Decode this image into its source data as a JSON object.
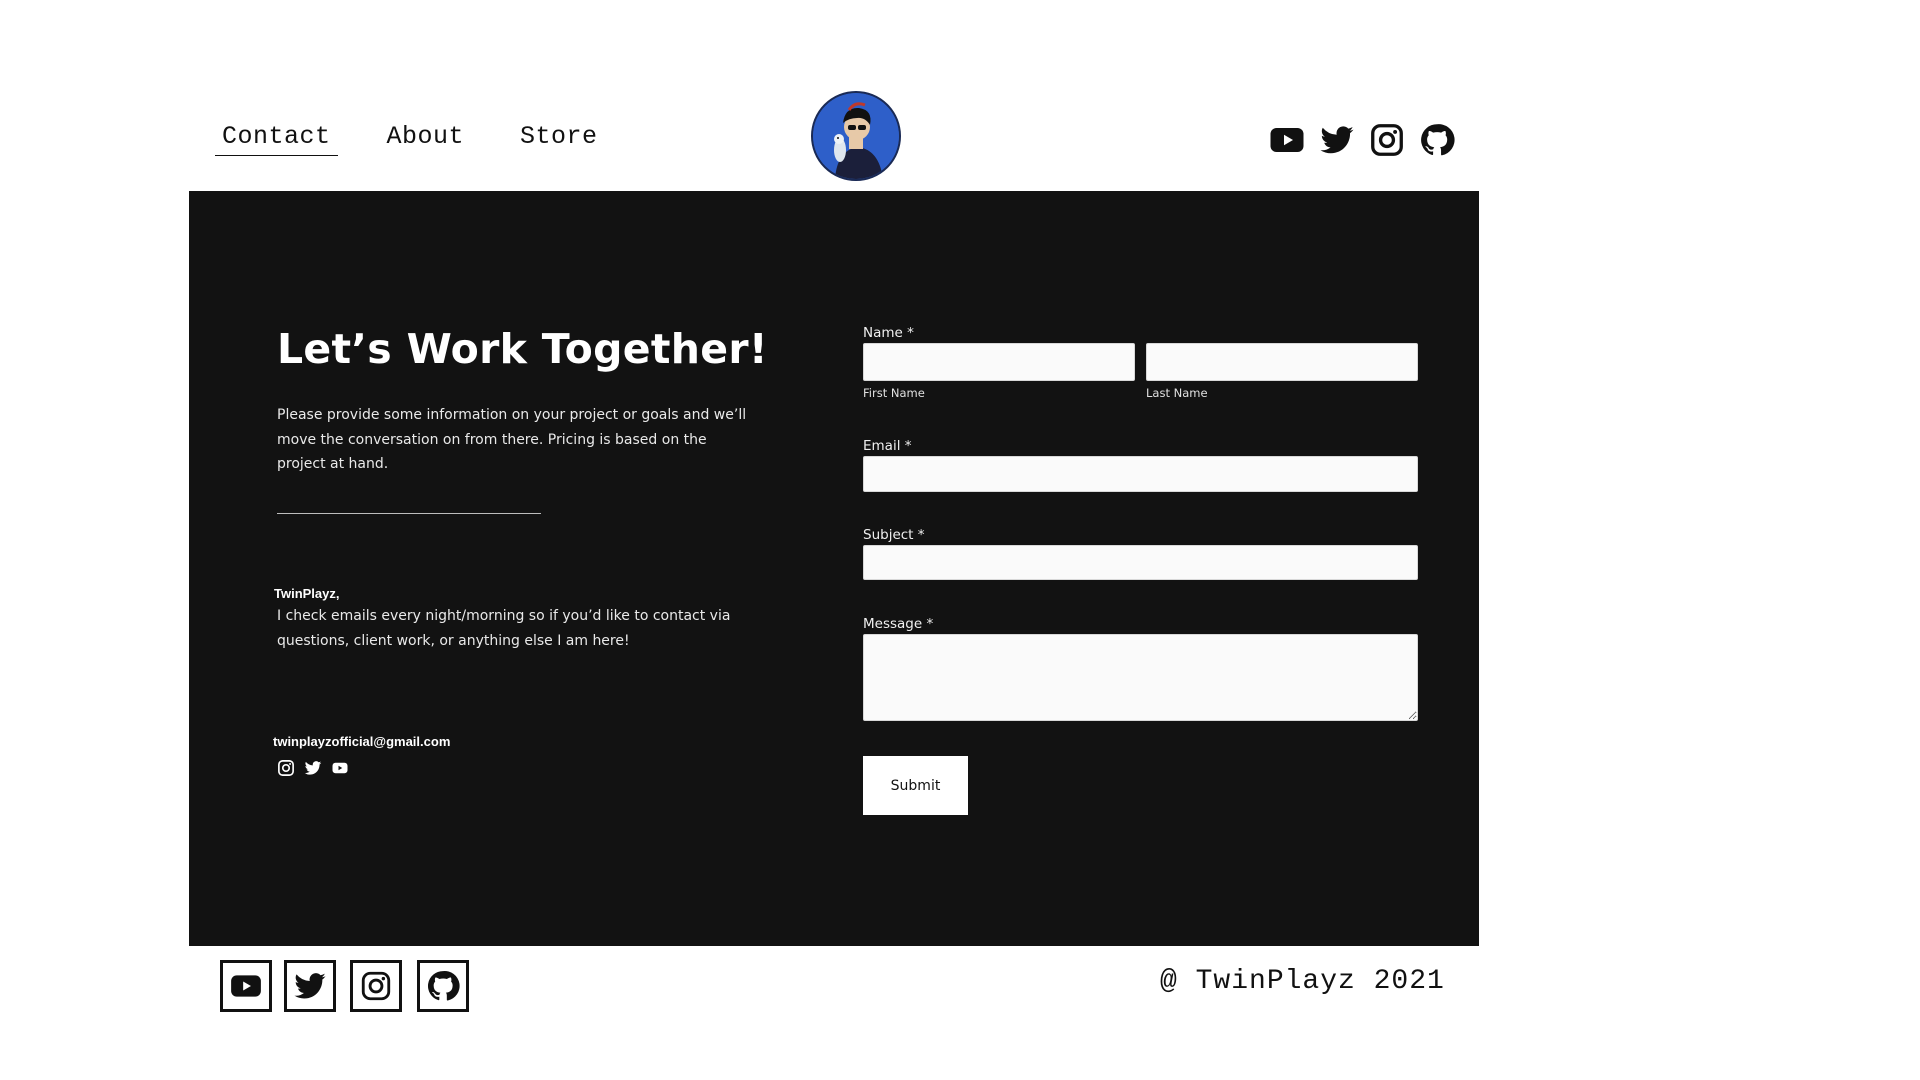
{
  "nav": {
    "items": [
      {
        "label": "Contact",
        "active": true
      },
      {
        "label": "About",
        "active": false
      },
      {
        "label": "Store",
        "active": false
      }
    ]
  },
  "header": {
    "logo_icon": "avatar-person-with-dog",
    "social_icons": [
      "youtube-icon",
      "twitter-icon",
      "instagram-icon",
      "github-icon"
    ]
  },
  "contact": {
    "title": "Let’s Work Together!",
    "intro": "Please provide some information on your project or goals and we’ll move the conversation on from there. Pricing is based on the project at hand.",
    "signature": "TwinPlayz,",
    "note": "I check emails every night/morning so if you’d like to contact via questions, client work, or anything else I am here!",
    "email": "twinplayzofficial@gmail.com",
    "social_icons": [
      "instagram-icon",
      "twitter-icon",
      "youtube-icon"
    ]
  },
  "form": {
    "name_label": "Name *",
    "first_name_label": "First Name",
    "last_name_label": "Last Name",
    "first_name_value": "",
    "last_name_value": "",
    "email_label": "Email *",
    "email_value": "",
    "subject_label": "Subject *",
    "subject_value": "",
    "message_label": "Message *",
    "message_value": "",
    "submit_label": "Submit"
  },
  "footer": {
    "social_icons": [
      "youtube-icon",
      "twitter-icon",
      "instagram-icon",
      "github-icon"
    ],
    "copyright": "@ TwinPlayz 2021"
  },
  "colors": {
    "panel_bg": "#121212",
    "page_bg": "#ffffff",
    "text_dark": "#111111",
    "input_bg": "#fafafa",
    "logo_bg": "#2e5fc9"
  }
}
